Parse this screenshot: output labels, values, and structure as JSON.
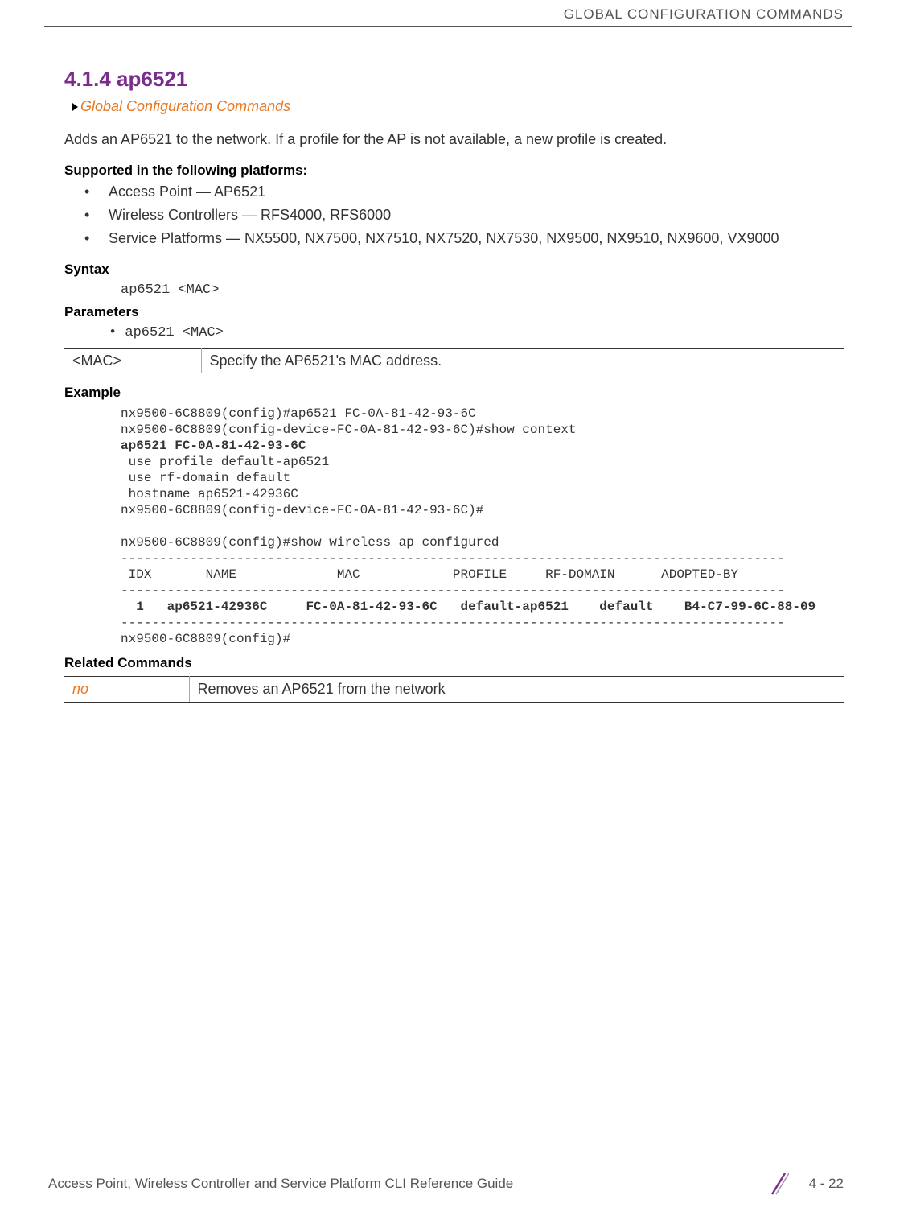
{
  "header": {
    "title": "GLOBAL CONFIGURATION COMMANDS"
  },
  "section": {
    "number_title": "4.1.4 ap6521",
    "breadcrumb": "Global Configuration Commands",
    "description": "Adds an AP6521 to the network. If a profile for the AP is not available, a new profile is created."
  },
  "platforms": {
    "heading": "Supported in the following platforms:",
    "items": [
      "Access Point — AP6521",
      "Wireless Controllers — RFS4000, RFS6000",
      "Service Platforms — NX5500, NX7500, NX7510, NX7520, NX7530, NX9500, NX9510, NX9600, VX9000"
    ]
  },
  "syntax": {
    "heading": "Syntax",
    "code": "ap6521 <MAC>"
  },
  "parameters": {
    "heading": "Parameters",
    "bullet": "• ap6521 <MAC>",
    "table": {
      "param": "<MAC>",
      "desc": "Specify the AP6521's MAC address."
    }
  },
  "example": {
    "heading": "Example",
    "lines": [
      {
        "text": "nx9500-6C8809(config)#ap6521 FC-0A-81-42-93-6C",
        "bold": false
      },
      {
        "text": "nx9500-6C8809(config-device-FC-0A-81-42-93-6C)#show context",
        "bold": false
      },
      {
        "text": "ap6521 FC-0A-81-42-93-6C",
        "bold": true
      },
      {
        "text": " use profile default-ap6521",
        "bold": false
      },
      {
        "text": " use rf-domain default",
        "bold": false
      },
      {
        "text": " hostname ap6521-42936C",
        "bold": false
      },
      {
        "text": "nx9500-6C8809(config-device-FC-0A-81-42-93-6C)#",
        "bold": false
      },
      {
        "text": "",
        "bold": false
      },
      {
        "text": "nx9500-6C8809(config)#show wireless ap configured",
        "bold": false
      },
      {
        "text": "--------------------------------------------------------------------------------------",
        "bold": false
      },
      {
        "text": " IDX       NAME             MAC            PROFILE     RF-DOMAIN      ADOPTED-BY",
        "bold": false
      },
      {
        "text": "--------------------------------------------------------------------------------------",
        "bold": false
      },
      {
        "text": "  1   ap6521-42936C     FC-0A-81-42-93-6C   default-ap6521    default    B4-C7-99-6C-88-09",
        "bold": true
      },
      {
        "text": "--------------------------------------------------------------------------------------",
        "bold": false
      },
      {
        "text": "nx9500-6C8809(config)#",
        "bold": false
      }
    ]
  },
  "related": {
    "heading": "Related Commands",
    "table": {
      "cmd": "no",
      "desc": "Removes an AP6521 from the network"
    }
  },
  "footer": {
    "left": "Access Point, Wireless Controller and Service Platform CLI Reference Guide",
    "page": "4 - 22"
  }
}
